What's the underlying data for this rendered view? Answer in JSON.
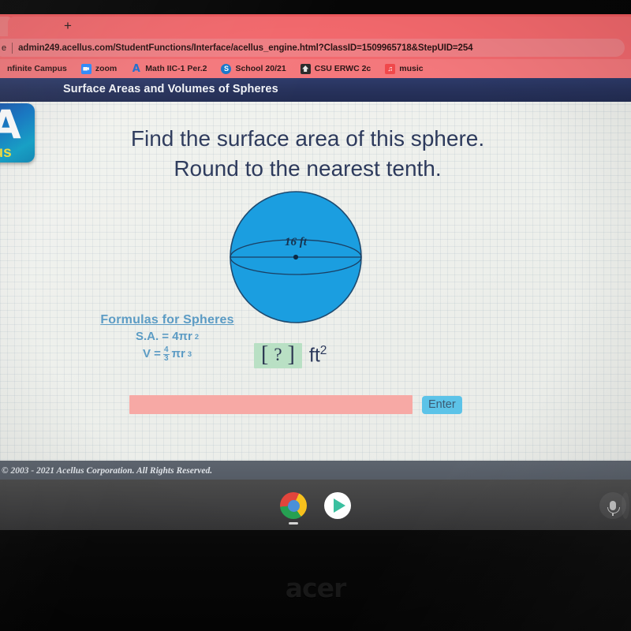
{
  "browser": {
    "new_tab_label": "+",
    "omnibox": {
      "prefix": "e",
      "url": "admin249.acellus.com/StudentFunctions/Interface/acellus_engine.html?ClassID=1509965718&StepUID=254"
    },
    "bookmarks": [
      {
        "label": "nfinite Campus",
        "icon": "none"
      },
      {
        "label": "zoom",
        "icon": "zoom-icon"
      },
      {
        "label": "Math IIC-1 Per.2",
        "icon": "acellus-icon"
      },
      {
        "label": "School 20/21",
        "icon": "school-icon"
      },
      {
        "label": "CSU ERWC 2c",
        "icon": "csu-icon"
      },
      {
        "label": "music",
        "icon": "music-icon"
      }
    ]
  },
  "page": {
    "header_title": "Surface Areas and Volumes of Spheres",
    "logo": {
      "letter": "A",
      "word": "llus"
    },
    "question_line1": "Find the surface area of this sphere.",
    "question_line2": "Round to the nearest tenth.",
    "figure": {
      "label": "16 ft",
      "sphere_fill": "#1b9ee0",
      "sphere_stroke": "#1f4f78"
    },
    "formulas": {
      "title": "Formulas for Spheres",
      "surface_area_prefix": "S.A. = 4πr",
      "surface_area_power": "2",
      "volume_prefix": "V = ",
      "volume_numerator": "4",
      "volume_denominator": "3",
      "volume_suffix": "πr",
      "volume_power": "3"
    },
    "answer": {
      "left_bracket": "[",
      "placeholder_mark": "?",
      "right_bracket": "]",
      "unit": "ft",
      "unit_power": "2"
    },
    "input": {
      "value": "",
      "placeholder": ""
    },
    "enter_label": "Enter",
    "copyright": "© 2003 - 2021 Acellus Corporation.  All Rights Reserved."
  },
  "shelf": {
    "items": [
      {
        "name": "chrome-icon"
      },
      {
        "name": "google-play-icon"
      }
    ],
    "mic_label": "microphone-icon"
  },
  "device": {
    "brand": "acer"
  },
  "colors": {
    "browser_chrome": "#f3696e",
    "page_header": "#27325c",
    "sphere": "#1b9ee0",
    "enter_button": "#5cc3e8",
    "input_field": "#f7a9a5",
    "answer_box": "#b9e0c4",
    "formula_text": "#5b9bc4"
  }
}
